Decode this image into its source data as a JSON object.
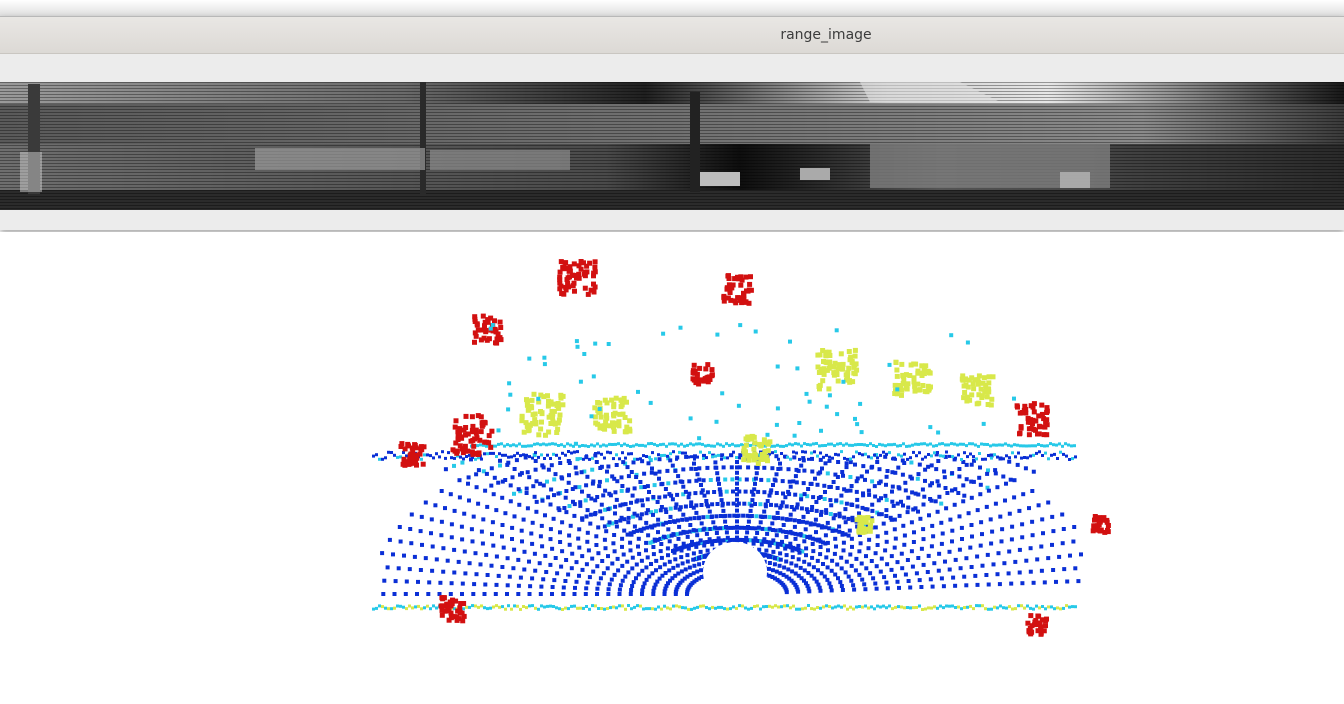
{
  "window": {
    "title": "range_image"
  },
  "range_image": {
    "colormap": "grayscale",
    "background": "#1a1a1a"
  },
  "point_cloud": {
    "colormap": "jet",
    "colors": {
      "near": "#0a2fd6",
      "mid": "#27c9e8",
      "far_mid": "#d8e84a",
      "far": "#d21010"
    }
  }
}
